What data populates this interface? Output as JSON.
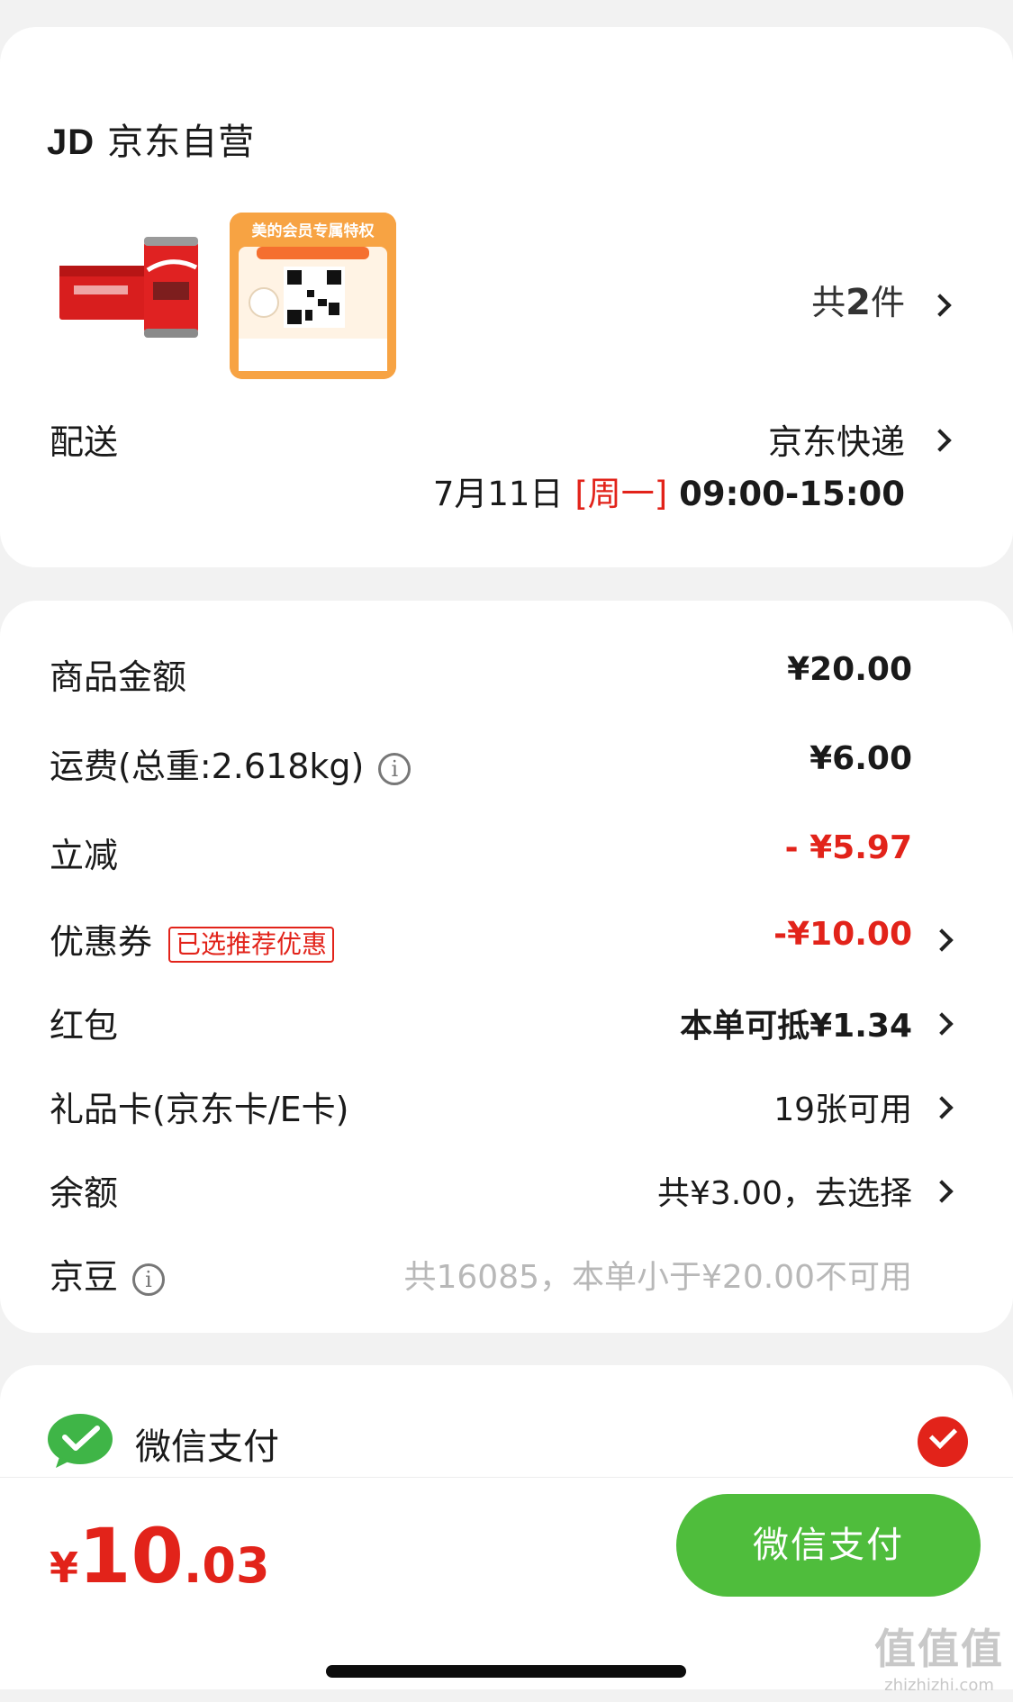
{
  "colors": {
    "accent_red": "#e2231a",
    "wechat_green": "#4fbd3c",
    "background": "#f2f2f2"
  },
  "order": {
    "shop_logo": "JD",
    "shop_name": "京东自营",
    "items": [
      {
        "icon": "coke-can-product-image"
      },
      {
        "icon": "midea-member-card-image",
        "card_title": "美的会员专属特权"
      }
    ],
    "count_prefix": "共",
    "count_value": "2",
    "count_suffix": "件"
  },
  "delivery": {
    "label": "配送",
    "carrier": "京东快递",
    "date": "7月11日",
    "day": "[周一]",
    "time": "09:00-15:00"
  },
  "costs": {
    "goods": {
      "label": "商品金额",
      "value": "¥20.00"
    },
    "shipping": {
      "label": "运费(总重:2.618kg)",
      "value": "¥6.00"
    },
    "instant_discount": {
      "label": "立减",
      "value": "- ¥5.97"
    },
    "coupon": {
      "label": "优惠券",
      "tag": "已选推荐优惠",
      "value": "-¥10.00"
    },
    "red_packet": {
      "label": "红包",
      "value": "本单可抵¥1.34"
    },
    "gift_card": {
      "label": "礼品卡(京东卡/E卡)",
      "value": "19张可用"
    },
    "balance": {
      "label": "余额",
      "value": "共¥3.00，去选择"
    },
    "jd_beans": {
      "label": "京豆",
      "value": "共16085，本单小于¥20.00不可用"
    }
  },
  "payment": {
    "method_label": "微信支付",
    "selected": true
  },
  "footer": {
    "price_symbol": "¥",
    "price_int": "10",
    "price_dec": ".03",
    "pay_button": "微信支付"
  },
  "watermark": {
    "big": "值值值",
    "small": "zhizhizhi.com"
  }
}
